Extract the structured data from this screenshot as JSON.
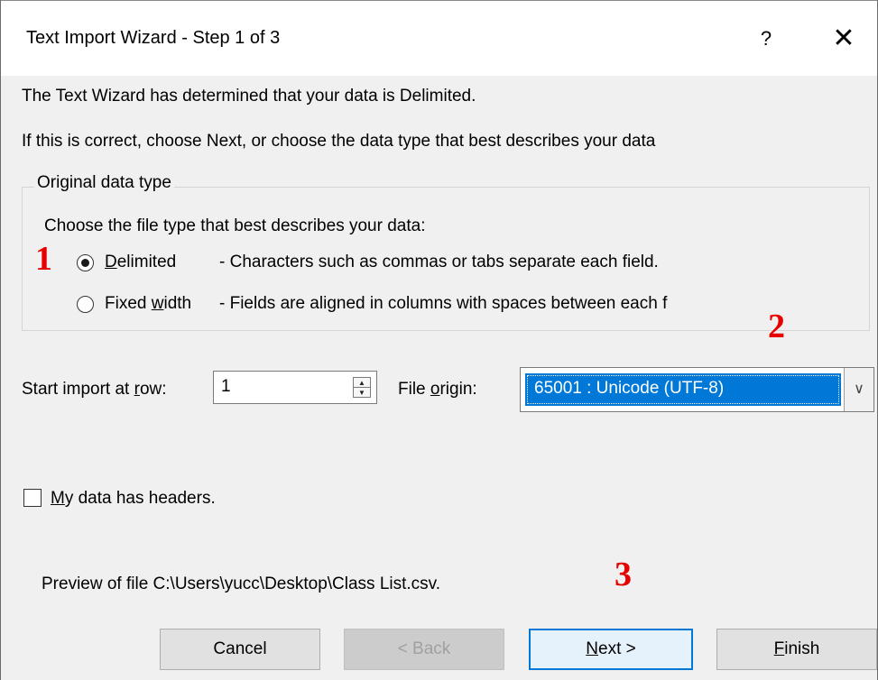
{
  "window": {
    "title": "Text Import Wizard - Step 1 of 3",
    "help_glyph": "?",
    "close_glyph": "✕"
  },
  "intro": {
    "line1": "The Text Wizard has determined that your data is Delimited.",
    "line2": "If this is correct, choose Next, or choose the data type that best describes your data"
  },
  "original_data_type": {
    "legend": "Original data type",
    "prompt": "Choose the file type that best describes your data:",
    "options": [
      {
        "label_pre": "",
        "label_key": "D",
        "label_post": "elimited",
        "description": "- Characters such as commas or tabs separate each field.",
        "selected": true
      },
      {
        "label_pre": "Fixed ",
        "label_key": "w",
        "label_post": "idth",
        "description": "- Fields are aligned in columns with spaces between each f",
        "selected": false
      }
    ]
  },
  "start_row": {
    "label_pre": "Start import at ",
    "label_key": "r",
    "label_post": "ow:",
    "value": "1"
  },
  "file_origin": {
    "label_pre": "File ",
    "label_key": "o",
    "label_post": "rigin:",
    "selected": "65001 : Unicode (UTF-8)",
    "arrow_glyph": "∨"
  },
  "headers_checkbox": {
    "label_key": "M",
    "label_post": "y data has headers.",
    "checked": false
  },
  "preview": {
    "text": "Preview of file C:\\Users\\yucc\\Desktop\\Class List.csv."
  },
  "annotations": {
    "marker1": "1",
    "marker2": "2",
    "marker3": "3"
  },
  "buttons": {
    "cancel": "Cancel",
    "back": "< Back",
    "next_key": "N",
    "next_post": "ext >",
    "finish_key": "F",
    "finish_post": "inish"
  },
  "colors": {
    "selection": "#0078d7",
    "annotation": "#e60000",
    "dialog_bg": "#f0f0f0"
  }
}
